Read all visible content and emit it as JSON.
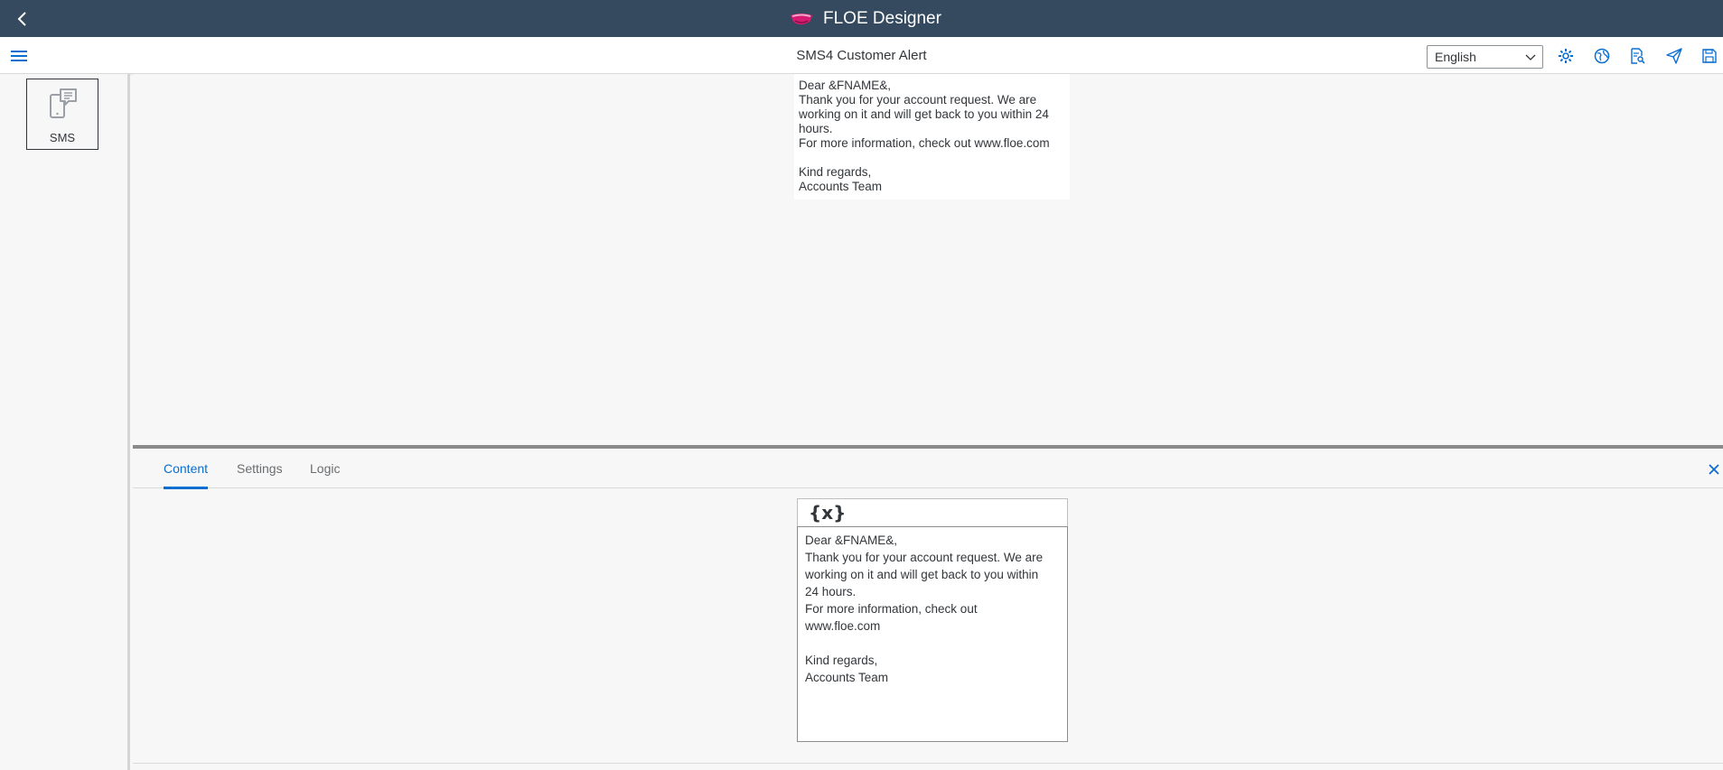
{
  "app": {
    "title": "FLOE Designer",
    "brand_colors": {
      "shell": "#354a5f",
      "accent": "#0a6ed1",
      "logo": "#d81b72"
    }
  },
  "header": {
    "page_title": "SMS4 Customer Alert",
    "language": "English",
    "tool_icons": [
      "settings-cog-icon",
      "globe-icon",
      "document-search-icon",
      "send-icon",
      "save-icon"
    ]
  },
  "palette": {
    "items": [
      {
        "label": "SMS",
        "icon": "sms-phone-icon"
      }
    ]
  },
  "preview": {
    "lines": [
      "Dear &FNAME&,",
      "Thank you for your account request. We are",
      "working on it and will get back to you within 24",
      "hours.",
      "For more information, check out www.floe.com",
      "",
      "Kind regards,",
      "Accounts Team"
    ]
  },
  "panel": {
    "tabs": [
      {
        "label": "Content",
        "active": true
      },
      {
        "label": "Settings",
        "active": false
      },
      {
        "label": "Logic",
        "active": false
      }
    ],
    "variable_button": "{x}",
    "editor_lines": [
      "Dear &FNAME&,",
      "Thank you for your account request. We are",
      "working on it and will get back to you within",
      "24 hours.",
      "For more information, check out",
      "www.floe.com",
      "",
      "Kind regards,",
      "Accounts Team"
    ]
  }
}
